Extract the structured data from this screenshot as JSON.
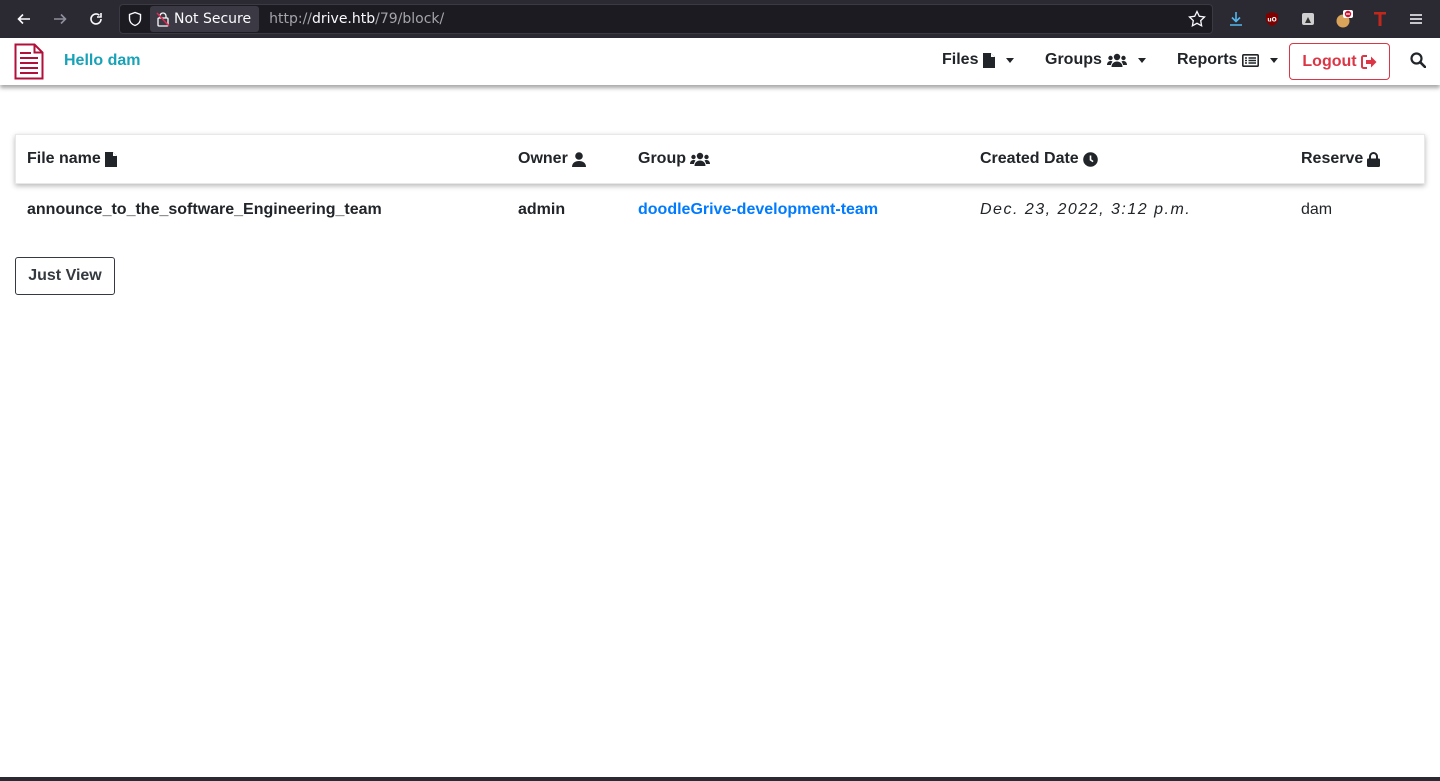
{
  "browser": {
    "security_label": "Not Secure",
    "url_scheme": "http://",
    "url_host": "drive.htb",
    "url_path": "/79/block/"
  },
  "navbar": {
    "greeting": "Hello dam",
    "menus": [
      {
        "label": "Files",
        "icon": "file-icon"
      },
      {
        "label": "Groups",
        "icon": "users-icon"
      },
      {
        "label": "Reports",
        "icon": "list-alt-icon"
      }
    ],
    "logout_label": "Logout",
    "colors": {
      "greeting": "#17a2b8",
      "logout": "#dc3545",
      "brand_icon": "#b0103a"
    }
  },
  "table": {
    "headers": [
      {
        "label": "File name",
        "icon": "file-icon"
      },
      {
        "label": "Owner",
        "icon": "user-icon"
      },
      {
        "label": "Group",
        "icon": "users-icon"
      },
      {
        "label": "Created Date",
        "icon": "clock-icon"
      },
      {
        "label": "Reserve",
        "icon": "lock-icon"
      }
    ],
    "rows": [
      {
        "file_name": "announce_to_the_software_Engineering_team",
        "owner": "admin",
        "group": "doodleGrive-development-team",
        "created_date": "Dec. 23, 2022, 3:12 p.m.",
        "reserve": "dam"
      }
    ]
  },
  "actions": {
    "just_view_label": "Just View"
  }
}
